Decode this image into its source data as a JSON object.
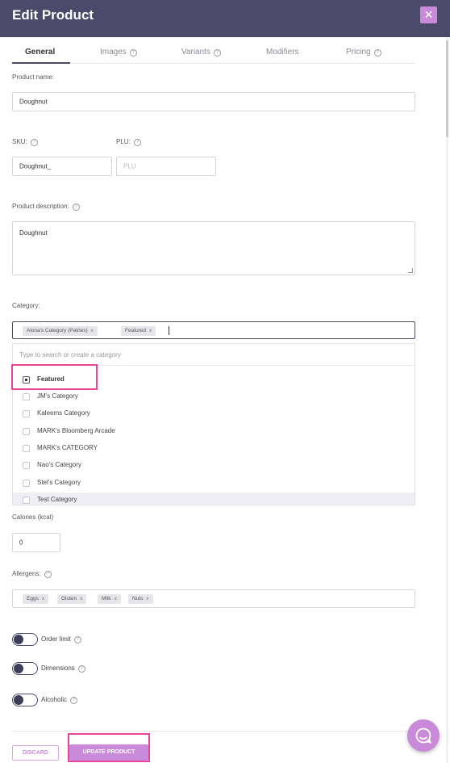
{
  "header": {
    "title": "Edit Product",
    "close_glyph": "✕"
  },
  "tabs": [
    {
      "label": "General",
      "active": true,
      "help": false
    },
    {
      "label": "Images",
      "active": false,
      "help": true
    },
    {
      "label": "Variants",
      "active": false,
      "help": true
    },
    {
      "label": "Modifiers",
      "active": false,
      "help": false
    },
    {
      "label": "Pricing",
      "active": false,
      "help": true
    }
  ],
  "form": {
    "product_name": {
      "label": "Product name:",
      "value": "Doughnut"
    },
    "sku": {
      "label": "SKU:",
      "value": "Doughnut_"
    },
    "plu": {
      "label": "PLU:",
      "placeholder": "PLU"
    },
    "description": {
      "label": "Product description:",
      "value": "Doughnut"
    },
    "category": {
      "label": "Category:",
      "chips": [
        "Alona's Category (Patries)",
        "Featured"
      ],
      "search_placeholder": "Type to search or create a category",
      "options": [
        {
          "label": "Featured",
          "checked": true
        },
        {
          "label": "JM's Category",
          "checked": false
        },
        {
          "label": "Kaleems Category",
          "checked": false
        },
        {
          "label": "MARK's Bloomberg Arcade",
          "checked": false
        },
        {
          "label": "MARK's CATEGORY",
          "checked": false
        },
        {
          "label": "Nao's Category",
          "checked": false
        },
        {
          "label": "Stel's Category",
          "checked": false
        },
        {
          "label": "Test Category",
          "checked": false
        }
      ]
    },
    "calories": {
      "label": "Calories (kcal)",
      "value": "0"
    },
    "allergens": {
      "label": "Allergens:",
      "chips": [
        "Eggs",
        "Gluten",
        "Milk",
        "Nuts"
      ]
    },
    "toggles": [
      {
        "label": "Order limit",
        "on": false
      },
      {
        "label": "Dimensions",
        "on": false
      },
      {
        "label": "Alcoholic",
        "on": false
      }
    ]
  },
  "footer": {
    "discard_label": "DISCARD",
    "update_label": "UPDATE PRODUCT"
  },
  "colors": {
    "header_bg": "#4b4a6b",
    "accent": "#c98bd9",
    "highlight": "#e8459b"
  },
  "icons": {
    "help": "?",
    "chip_remove": "x"
  }
}
